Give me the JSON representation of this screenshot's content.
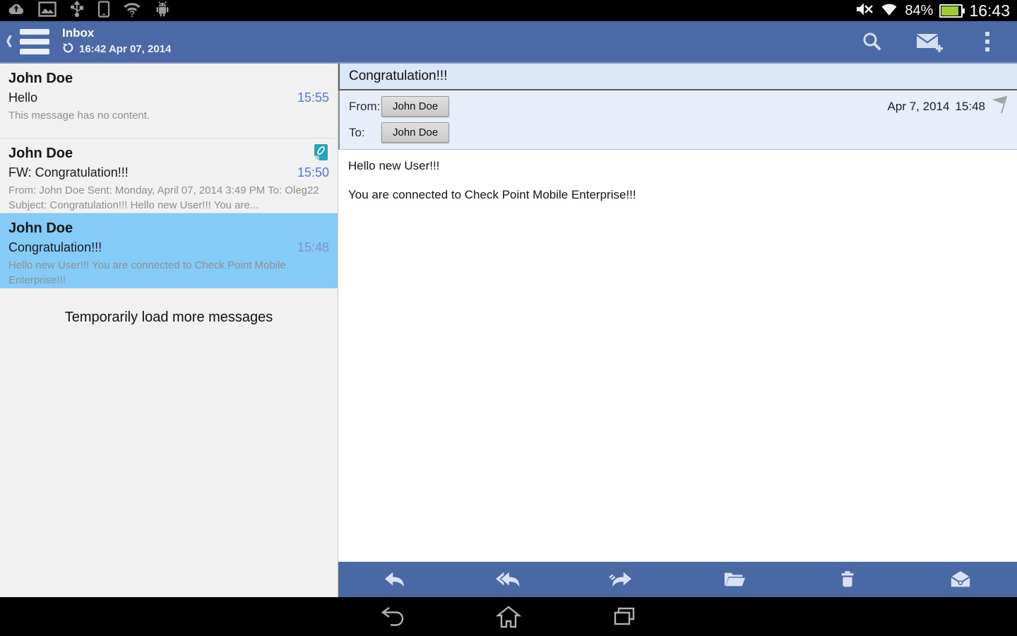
{
  "status_bar": {
    "left_icon_names": [
      "cloud-upload-icon",
      "gallery-icon",
      "usb-icon",
      "tablet-icon",
      "wifi-question-icon",
      "android-icon"
    ],
    "right_icon_names": [
      "mute-icon",
      "wifi-icon",
      "battery-icon"
    ],
    "battery_percent": "84%",
    "clock": "16:43"
  },
  "app_bar": {
    "title": "Inbox",
    "sync_label": "16:42 Apr 07, 2014",
    "icon_names": [
      "back-chevron-icon",
      "menu-icon",
      "refresh-icon",
      "search-icon",
      "compose-icon",
      "overflow-icon"
    ]
  },
  "message_list": {
    "items": [
      {
        "sender": "John Doe",
        "subject": "Hello",
        "time": "15:55",
        "snippet": "This message has no content.",
        "selected": false,
        "has_attachment": false
      },
      {
        "sender": "John Doe",
        "subject": "FW: Congratulation!!!",
        "time": "15:50",
        "snippet": "From: John Doe Sent: Monday, April 07, 2014 3:49 PM To: Oleg22 Subject: Congratulation!!! Hello new User!!! You are...",
        "selected": false,
        "has_attachment": true
      },
      {
        "sender": "John Doe",
        "subject": "Congratulation!!!",
        "time": "15:48",
        "snippet": "Hello new User!!! You are connected to Check Point Mobile Enterprise!!!",
        "selected": true,
        "has_attachment": false
      }
    ],
    "load_more_label": "Temporarily load more messages"
  },
  "reading_pane": {
    "subject": "Congratulation!!!",
    "from_label": "From:",
    "from_chip": "John Doe",
    "to_label": "To:",
    "to_chip": "John Doe",
    "date": "Apr 7, 2014",
    "time": "15:48",
    "flag_icon": "flag-icon",
    "body_lines": {
      "0": "Hello new User!!!",
      "1": "You are connected to Check Point Mobile Enterprise!!!"
    }
  },
  "toolbar": {
    "icon_names": [
      "reply-icon",
      "reply-all-icon",
      "forward-icon",
      "folder-icon",
      "delete-icon",
      "mark-unread-icon"
    ]
  },
  "nav_bar": {
    "icon_names": [
      "back-icon",
      "home-icon",
      "recents-icon"
    ]
  },
  "colors": {
    "app_bar": "#4a69a6",
    "toolbar": "#4a69a4",
    "selected_item": "#85cbf8",
    "time_accent": "#5575e2",
    "attachment_badge": "#23a7b8",
    "battery_fill": "#9ccb33"
  }
}
